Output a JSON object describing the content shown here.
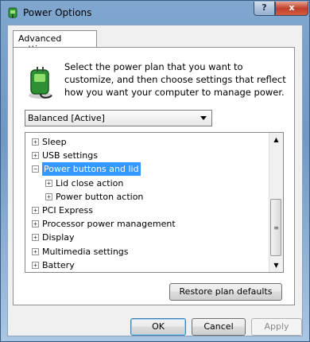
{
  "window": {
    "title": "Power Options",
    "help_glyph": "?",
    "close_glyph": "x"
  },
  "tab": {
    "label": "Advanced settings"
  },
  "intro": {
    "text": "Select the power plan that you want to customize, and then choose settings that reflect how you want your computer to manage power."
  },
  "plan_select": {
    "value": "Balanced [Active]"
  },
  "tree": {
    "items": [
      {
        "label": "Sleep",
        "expander": "+",
        "level": 0,
        "selected": false
      },
      {
        "label": "USB settings",
        "expander": "+",
        "level": 0,
        "selected": false
      },
      {
        "label": "Power buttons and lid",
        "expander": "−",
        "level": 0,
        "selected": true
      },
      {
        "label": "Lid close action",
        "expander": "+",
        "level": 1,
        "selected": false
      },
      {
        "label": "Power button action",
        "expander": "+",
        "level": 1,
        "selected": false
      },
      {
        "label": "PCI Express",
        "expander": "+",
        "level": 0,
        "selected": false
      },
      {
        "label": "Processor power management",
        "expander": "+",
        "level": 0,
        "selected": false
      },
      {
        "label": "Display",
        "expander": "+",
        "level": 0,
        "selected": false
      },
      {
        "label": "Multimedia settings",
        "expander": "+",
        "level": 0,
        "selected": false
      },
      {
        "label": "Battery",
        "expander": "+",
        "level": 0,
        "selected": false
      }
    ],
    "scroll": {
      "up_glyph": "▲",
      "down_glyph": "▼",
      "grip_glyph": "≡"
    }
  },
  "buttons": {
    "restore": "Restore plan defaults",
    "ok": "OK",
    "cancel": "Cancel",
    "apply": "Apply"
  },
  "colors": {
    "selection": "#3399ff",
    "close_button": "#c1402a"
  }
}
